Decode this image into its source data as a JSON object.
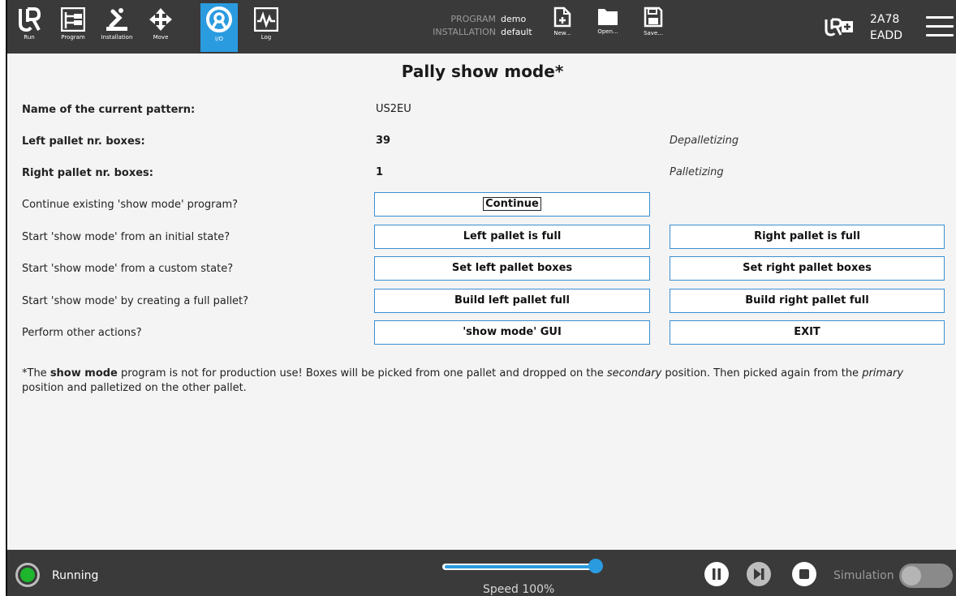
{
  "header": {
    "tabs": [
      {
        "label": "Run",
        "icon": "ur-logo-icon"
      },
      {
        "label": "Program",
        "icon": "program-tree-icon"
      },
      {
        "label": "Installation",
        "icon": "robot-arm-icon"
      },
      {
        "label": "Move",
        "icon": "move-arrows-icon"
      },
      {
        "label": "I/O",
        "icon": "io-icon"
      },
      {
        "label": "Log",
        "icon": "log-icon"
      }
    ],
    "active_tab": "I/O",
    "program_key": "PROGRAM",
    "program_value": "demo",
    "installation_key": "INSTALLATION",
    "installation_value": "default",
    "file_buttons": {
      "new": "New...",
      "open": "Open...",
      "save": "Save..."
    },
    "serial_line1": "2A78",
    "serial_line2": "EADD",
    "accent_color": "#2b9be0"
  },
  "main": {
    "title": "Pally show mode*",
    "pattern_label": "Name of the current pattern:",
    "pattern_value": "US2EU",
    "left_boxes_label": "Left pallet nr. boxes:",
    "left_boxes_value": "39",
    "left_mode": "Depalletizing",
    "right_boxes_label": "Right pallet nr. boxes:",
    "right_boxes_value": "1",
    "right_mode": "Palletizing",
    "rows": [
      {
        "label": "Continue existing 'show mode' program?",
        "button1": "Continue"
      },
      {
        "label": "Start 'show mode' from an initial state?",
        "button1": "Left pallet is full",
        "button2": "Right pallet is full"
      },
      {
        "label": "Start 'show mode' from a custom state?",
        "button1": "Set left pallet boxes",
        "button2": "Set right pallet boxes"
      },
      {
        "label": "Start 'show mode' by creating a full pallet?",
        "button1": "Build left pallet full",
        "button2": "Build right pallet full"
      },
      {
        "label": "Perform other actions?",
        "button1": "'show mode' GUI",
        "button2": "EXIT"
      }
    ],
    "footnote": {
      "p1": "*The ",
      "b1": "show mode",
      "p2": " program is not for production use! Boxes will be picked from one pallet and dropped on the ",
      "i1": "secondary",
      "p3": " position. Then picked again from the ",
      "i2": "primary",
      "p4": " position and palletized on the other pallet."
    }
  },
  "footer": {
    "status": "Running",
    "status_color": "#1fb52d",
    "speed_text": "Speed 100%",
    "speed_fraction": 1.0,
    "simulation_label": "Simulation",
    "simulation_on": false
  }
}
